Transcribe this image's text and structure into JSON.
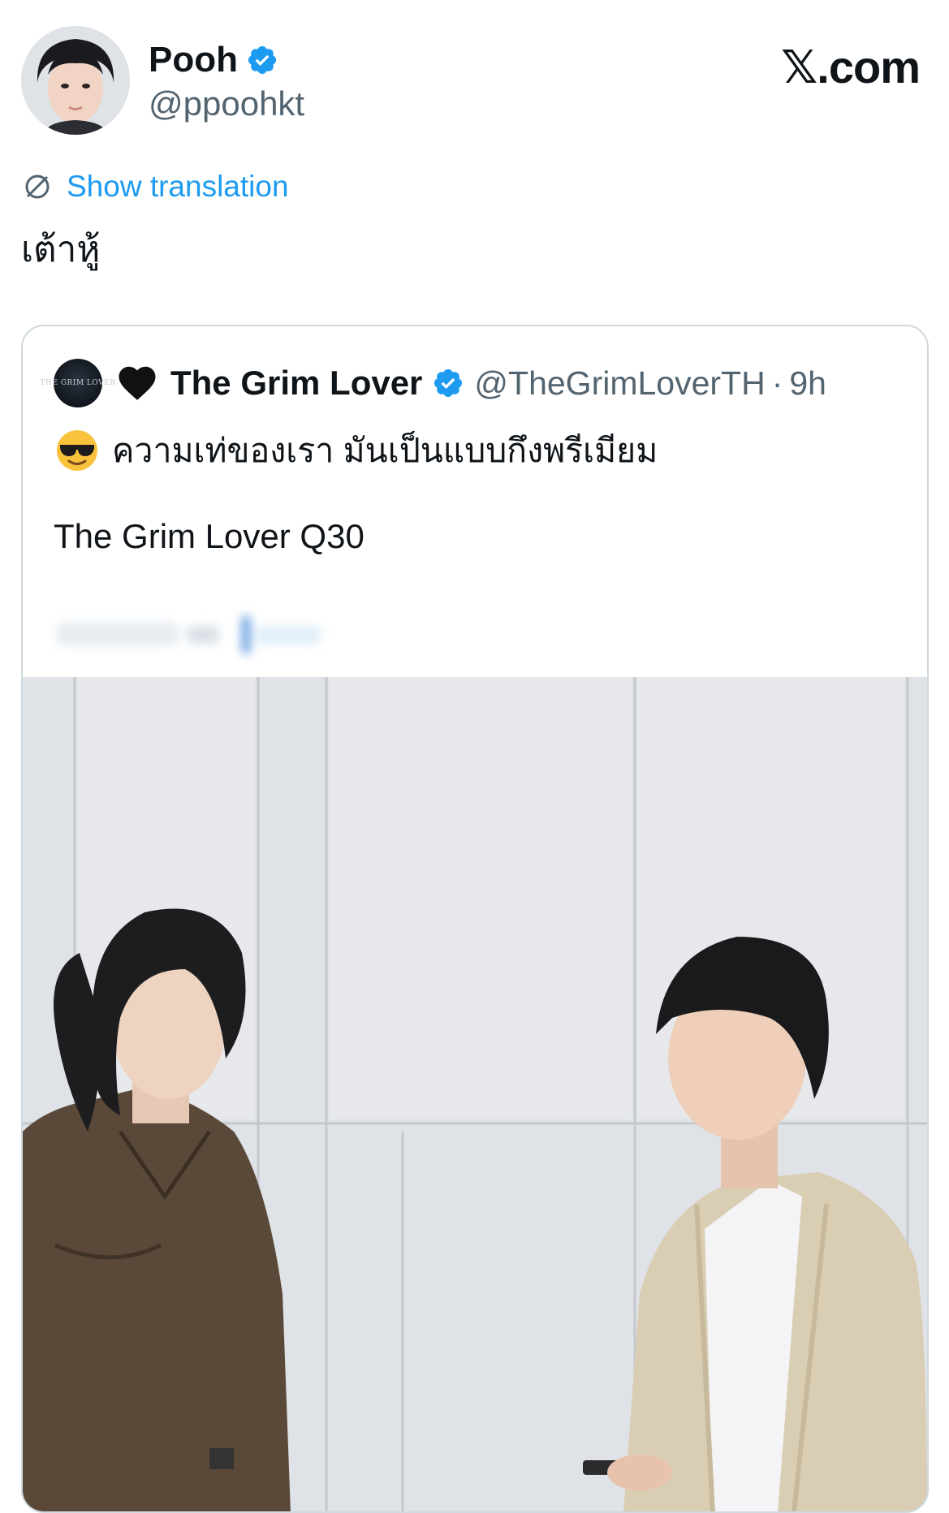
{
  "author": {
    "display_name": "Pooh",
    "handle": "@ppoohkt",
    "verified": true
  },
  "watermark": "𝕏.com",
  "translate": {
    "label": "Show translation"
  },
  "tweet": {
    "text": "เต้าหู้"
  },
  "quoted_tweet": {
    "display_name": "The Grim Lover",
    "handle": "@TheGrimLoverTH",
    "separator": "·",
    "time": "9h",
    "verified": true,
    "emoji_prefix": "black-heart",
    "text_line1": "ความเท่ของเรา มันเป็นแบบกึงพรีเมียม",
    "text_line1_emoji": "smiling-face-with-sunglasses",
    "text_line2": "The Grim Lover Q30",
    "avatar_text": "THE GRIM LOVER",
    "media": "photo of two men in front of a white wall"
  },
  "colors": {
    "accent": "#1d9bf0",
    "secondary_text": "#536471",
    "primary_text": "#0f1419",
    "border": "#cfd9de"
  }
}
